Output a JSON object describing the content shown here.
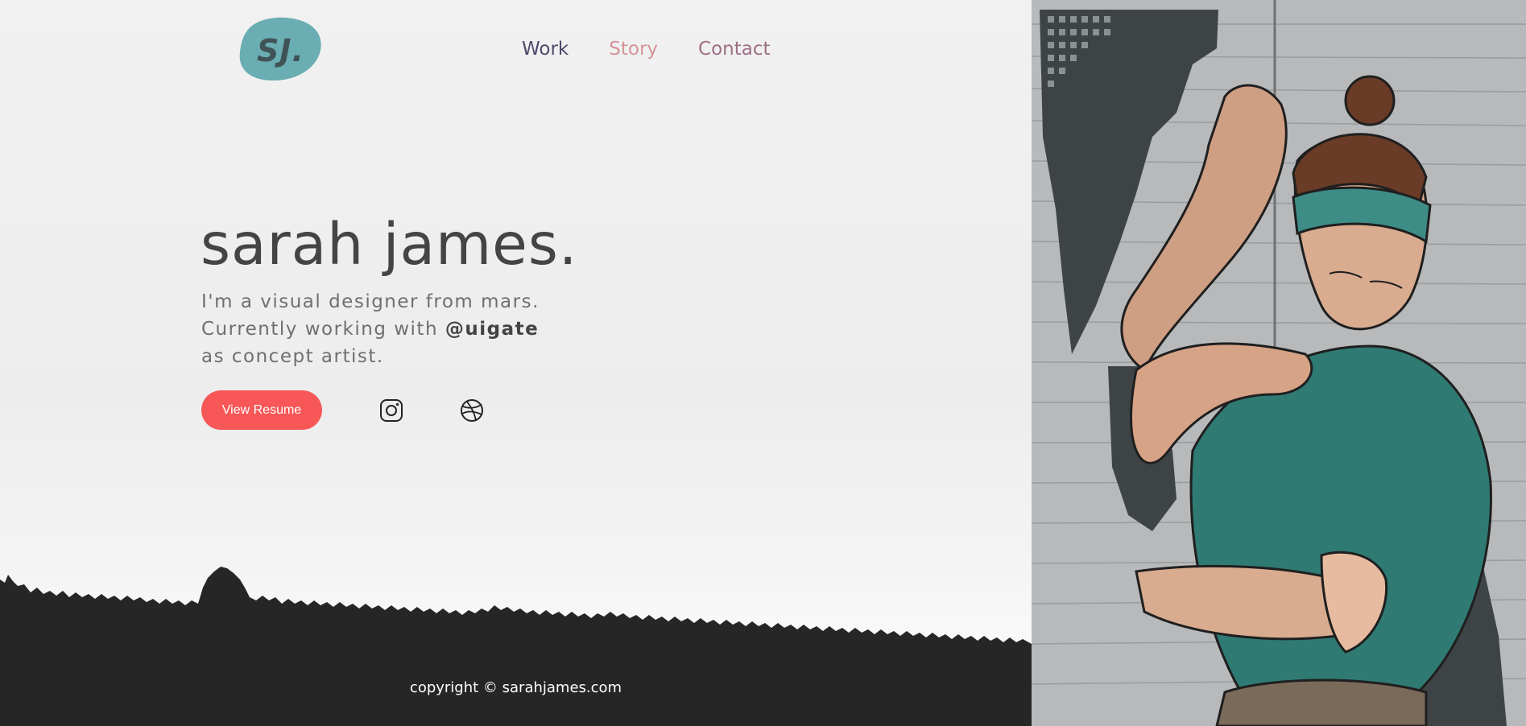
{
  "logo": {
    "text": "SJ."
  },
  "nav": {
    "items": [
      {
        "label": "Work"
      },
      {
        "label": "Story"
      },
      {
        "label": "Contact"
      }
    ]
  },
  "hero": {
    "title": "sarah james.",
    "line1": "I'm a visual designer from mars.",
    "line2_prefix": "Currently working with ",
    "line2_handle": "@uigate",
    "line3": "as concept artist."
  },
  "actions": {
    "resume_label": "View Resume",
    "social": [
      {
        "icon": "instagram-icon"
      },
      {
        "icon": "dribbble-icon"
      }
    ]
  },
  "footer": {
    "copyright": "copyright © sarahjames.com"
  },
  "colors": {
    "accent": "#f75757",
    "logo_blob": "#6aadb2",
    "nav_work": "#4d4a6b",
    "nav_story": "#d49499",
    "nav_contact": "#9e6e84",
    "title": "#444444",
    "footer_bg": "#2a2a2a"
  }
}
